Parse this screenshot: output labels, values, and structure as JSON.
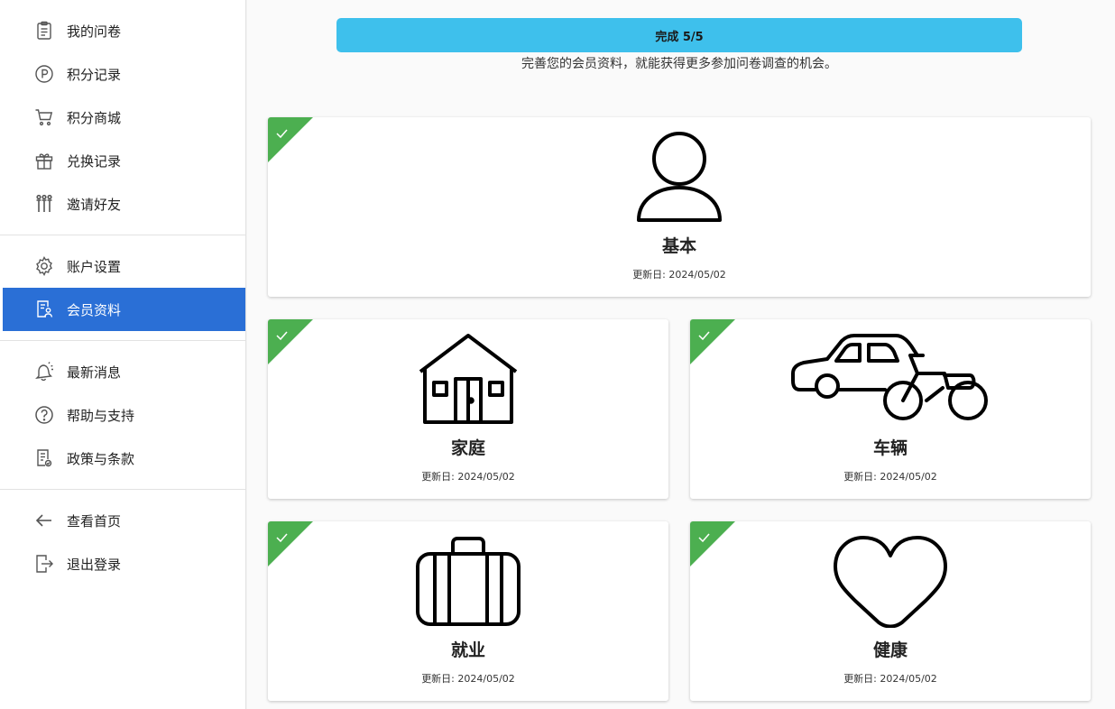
{
  "sidebar": {
    "groups": [
      [
        {
          "label": "我的问卷",
          "icon": "clipboard-icon"
        },
        {
          "label": "积分记录",
          "icon": "points-icon"
        },
        {
          "label": "积分商城",
          "icon": "cart-icon"
        },
        {
          "label": "兑换记录",
          "icon": "gift-icon"
        },
        {
          "label": "邀请好友",
          "icon": "people-icon"
        }
      ],
      [
        {
          "label": "账户设置",
          "icon": "gear-icon"
        },
        {
          "label": "会员资料",
          "icon": "profile-doc-icon",
          "active": true
        }
      ],
      [
        {
          "label": "最新消息",
          "icon": "bell-icon"
        },
        {
          "label": "帮助与支持",
          "icon": "help-icon"
        },
        {
          "label": "政策与条款",
          "icon": "policy-icon"
        }
      ],
      [
        {
          "label": "查看首页",
          "icon": "arrow-left-icon"
        },
        {
          "label": "退出登录",
          "icon": "logout-icon"
        }
      ]
    ]
  },
  "progress": {
    "label": "完成 5/5",
    "value": 5,
    "total": 5
  },
  "subtitle": "完善您的会员资料，就能获得更多参加问卷调查的机会。",
  "cards": [
    {
      "title": "基本",
      "date": "更新日: 2024/05/02",
      "icon": "person-icon",
      "completed": true
    },
    {
      "title": "家庭",
      "date": "更新日: 2024/05/02",
      "icon": "house-icon",
      "completed": true
    },
    {
      "title": "车辆",
      "date": "更新日: 2024/05/02",
      "icon": "car-motorcycle-icon",
      "completed": true
    },
    {
      "title": "就业",
      "date": "更新日: 2024/05/02",
      "icon": "briefcase-icon",
      "completed": true
    },
    {
      "title": "健康",
      "date": "更新日: 2024/05/02",
      "icon": "heart-icon",
      "completed": true
    }
  ],
  "colors": {
    "accent": "#2a6fd6",
    "progress": "#3ec0ec",
    "check": "#4caf50"
  }
}
